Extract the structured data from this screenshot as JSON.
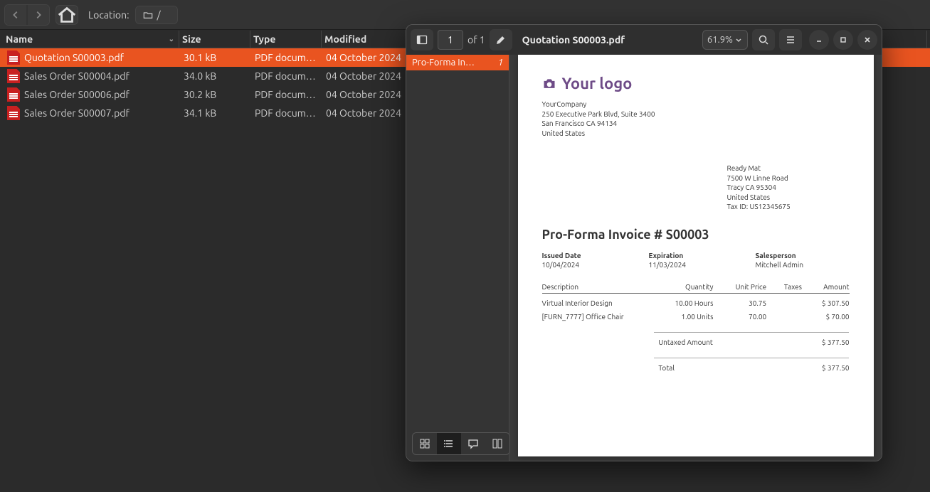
{
  "file_manager": {
    "location_label": "Location:",
    "path": "/",
    "columns": {
      "name": "Name",
      "size": "Size",
      "type": "Type",
      "modified": "Modified"
    },
    "rows": [
      {
        "name": "Quotation S00003.pdf",
        "size": "30.1 kB",
        "type": "PDF docum…",
        "modified": "04 October 2024",
        "selected": true
      },
      {
        "name": "Sales Order S00004.pdf",
        "size": "34.0 kB",
        "type": "PDF docum…",
        "modified": "04 October 2024",
        "selected": false
      },
      {
        "name": "Sales Order S00006.pdf",
        "size": "30.2 kB",
        "type": "PDF docum…",
        "modified": "04 October 2024",
        "selected": false
      },
      {
        "name": "Sales Order S00007.pdf",
        "size": "34.1 kB",
        "type": "PDF docum…",
        "modified": "04 October 2024",
        "selected": false
      }
    ]
  },
  "viewer": {
    "title": "Quotation S00003.pdf",
    "page_current": "1",
    "page_of": "of 1",
    "zoom": "61.9%",
    "outline": {
      "label": "Pro-Forma In…",
      "page": "1"
    }
  },
  "doc": {
    "logo_text": "Your logo",
    "company": {
      "name": "YourCompany",
      "addr1": "250 Executive Park Blvd, Suite 3400",
      "addr2": "San Francisco CA 94134",
      "addr3": "United States"
    },
    "customer": {
      "name": "Ready Mat",
      "addr1": "7500 W Linne Road",
      "addr2": "Tracy CA 95304",
      "addr3": "United States",
      "tax": "Tax ID: US12345675"
    },
    "title": "Pro-Forma Invoice # S00003",
    "meta": {
      "issued_h": "Issued Date",
      "issued": "10/04/2024",
      "exp_h": "Expiration",
      "exp": "11/03/2024",
      "sp_h": "Salesperson",
      "sp": "Mitchell Admin"
    },
    "cols": {
      "desc": "Description",
      "qty": "Quantity",
      "unit": "Unit Price",
      "tax": "Taxes",
      "amt": "Amount"
    },
    "lines": [
      {
        "desc": "Virtual Interior Design",
        "qty": "10.00 Hours",
        "unit": "30.75",
        "tax": "",
        "amt": "$ 307.50"
      },
      {
        "desc": "[FURN_7777] Office Chair",
        "qty": "1.00 Units",
        "unit": "70.00",
        "tax": "",
        "amt": "$ 70.00"
      }
    ],
    "totals": {
      "untaxed_l": "Untaxed Amount",
      "untaxed": "$ 377.50",
      "total_l": "Total",
      "total": "$ 377.50"
    }
  }
}
